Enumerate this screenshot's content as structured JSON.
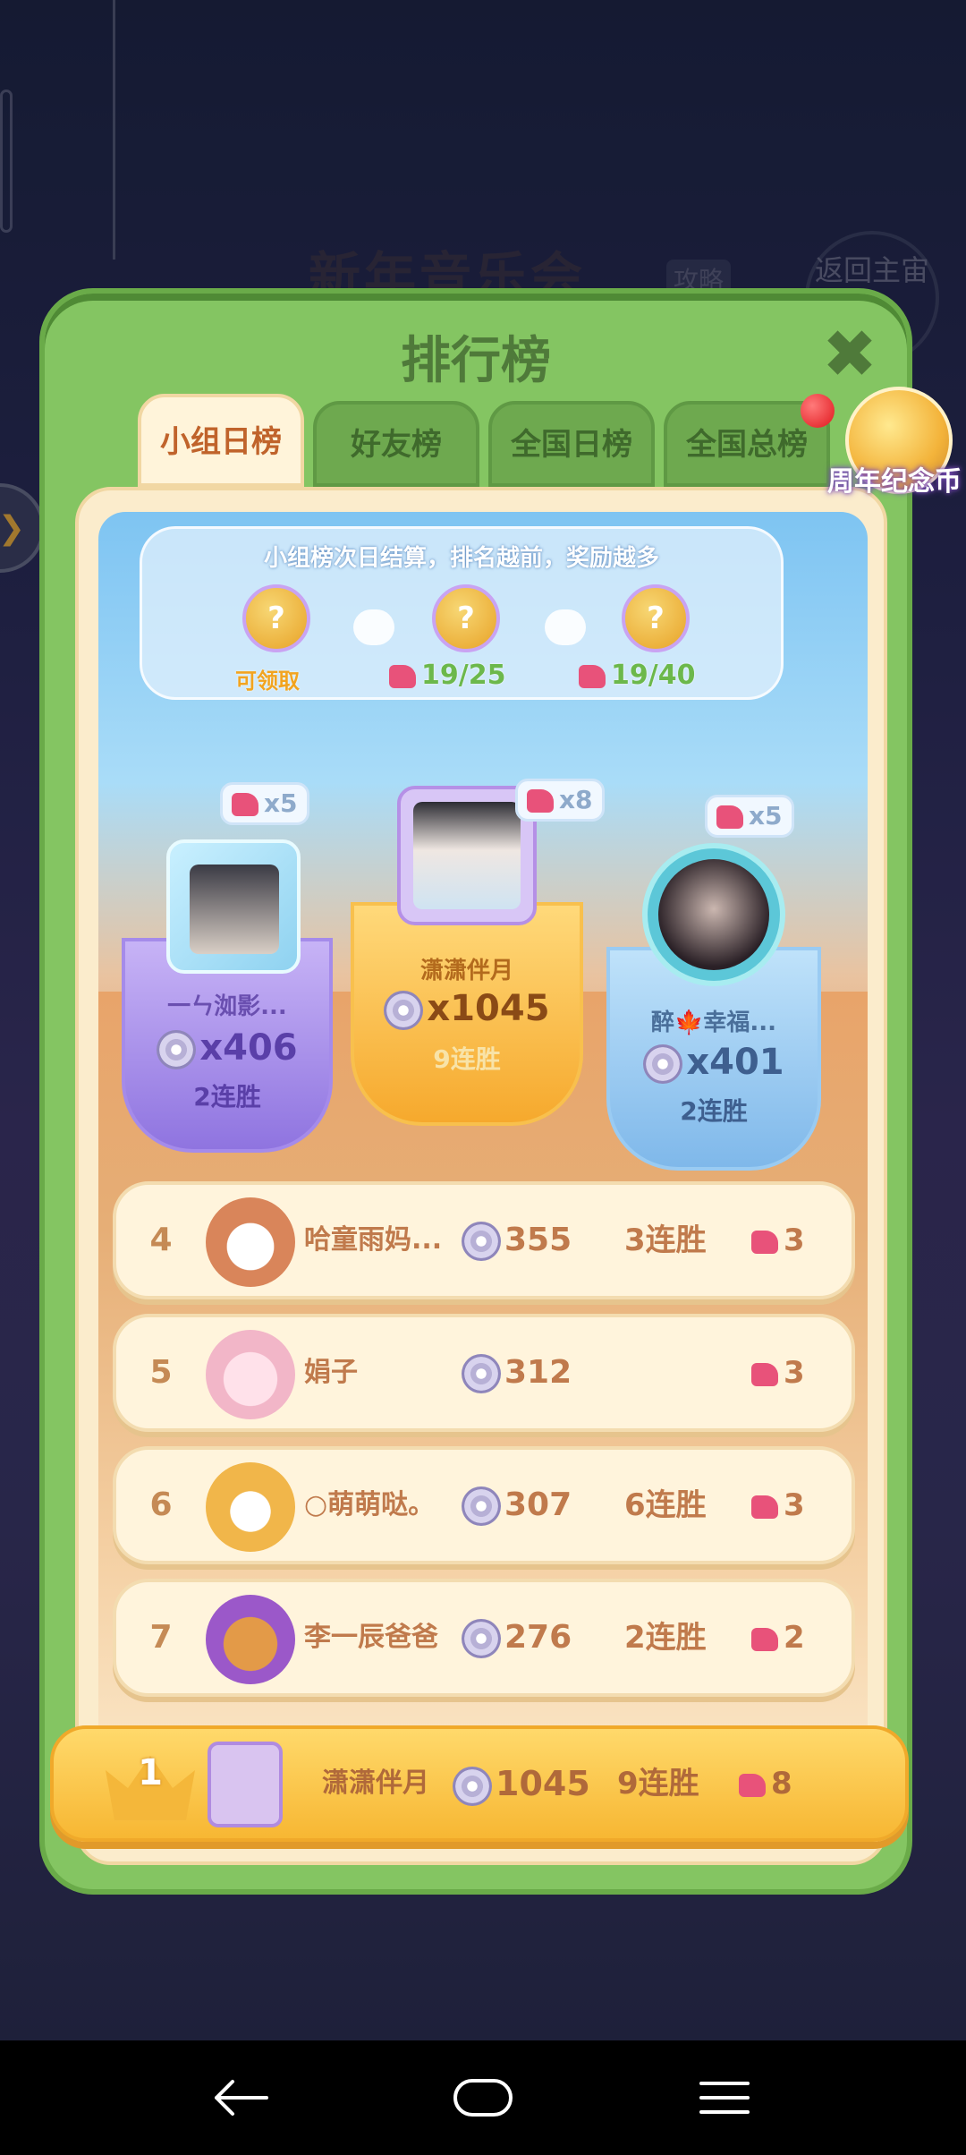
{
  "background": {
    "event_title": "新年音乐会",
    "strategy_label": "攻略",
    "back_label": "返回主宙"
  },
  "panel": {
    "title": "排行榜",
    "tabs": [
      {
        "label": "小组日榜",
        "active": true
      },
      {
        "label": "好友榜",
        "active": false
      },
      {
        "label": "全国日榜",
        "active": false
      },
      {
        "label": "全国总榜",
        "active": false
      }
    ],
    "anniversary_coin_label": "周年纪念币"
  },
  "rewards": {
    "info": "小组榜次日结算，排名越前，奖励越多",
    "chest_mark": "?",
    "claimable_label": "可领取",
    "progress_1": "19/25",
    "progress_2": "19/40"
  },
  "podium": {
    "first": {
      "name": "潇潇伴月",
      "score": "x1045",
      "streak": "9连胜",
      "flags": "x8"
    },
    "second": {
      "name": "一ㄣ洳影...",
      "score": "x406",
      "streak": "2连胜",
      "flags": "x5"
    },
    "third": {
      "name": "醉🍁幸福...",
      "score": "x401",
      "streak": "2连胜",
      "flags": "x5"
    }
  },
  "rows": [
    {
      "rank": "4",
      "name": "哈童雨妈...",
      "score": "355",
      "streak": "3连胜",
      "flags": "3"
    },
    {
      "rank": "5",
      "name": "娟子",
      "score": "312",
      "streak": "",
      "flags": "3"
    },
    {
      "rank": "6",
      "name": "○萌萌哒。",
      "score": "307",
      "streak": "6连胜",
      "flags": "3"
    },
    {
      "rank": "7",
      "name": "李一辰爸爸",
      "score": "276",
      "streak": "2连胜",
      "flags": "2"
    }
  ],
  "my_row": {
    "rank": "1",
    "name": "潇潇伴月",
    "score": "1045",
    "streak": "9连胜",
    "flags": "8"
  },
  "colors": {
    "panel_green": "#84c562",
    "tab_active_text": "#c0632b",
    "gold": "#f7b733",
    "row_text": "#c07a4c"
  }
}
